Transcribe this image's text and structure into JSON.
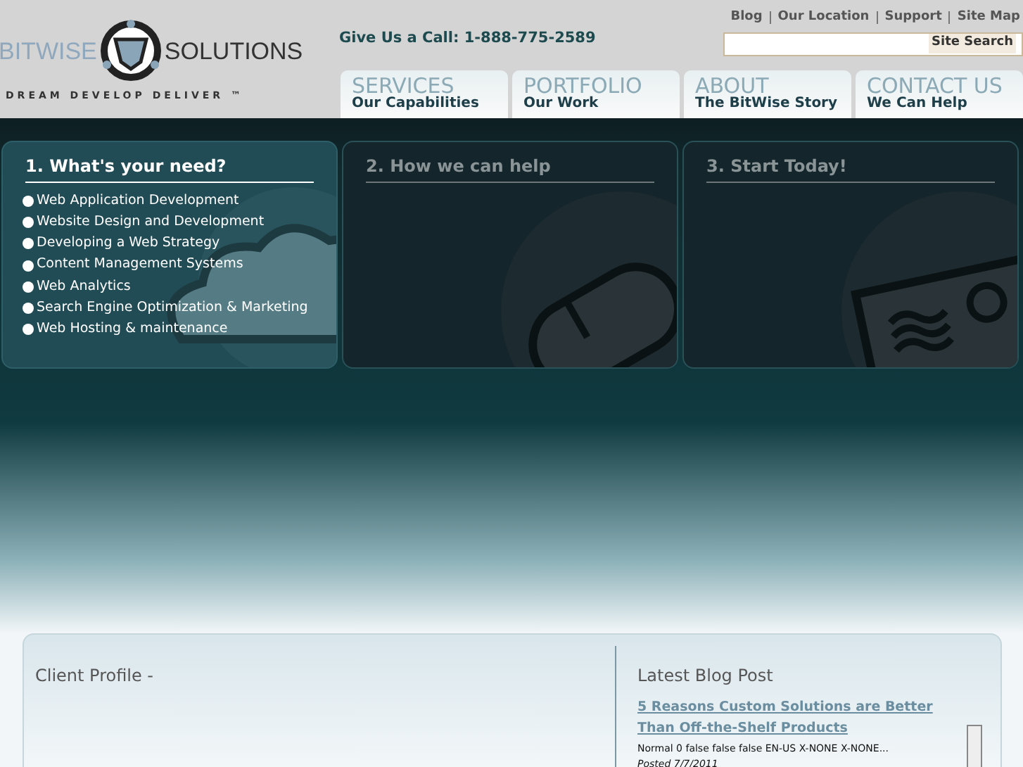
{
  "logo": {
    "left": "BITWISE",
    "right": "SOLUTIONS",
    "tagline": "DREAM DEVELOP DELIVER ™"
  },
  "phone": "Give Us a Call:  1-888-775-2589",
  "top_links": [
    "Blog",
    "Our Location",
    "Support",
    "Site Map"
  ],
  "search": {
    "button": "Site Search"
  },
  "nav": [
    {
      "title": "SERVICES",
      "subtitle": "Our Capabilities"
    },
    {
      "title": "PORTFOLIO",
      "subtitle": "Our Work"
    },
    {
      "title": "ABOUT",
      "subtitle": "The BitWise Story"
    },
    {
      "title": "CONTACT US",
      "subtitle": "We Can Help"
    }
  ],
  "panels": [
    {
      "kind": "cloud",
      "title": "1. What's your need?",
      "selected": true,
      "items": [
        "Web Application Development",
        "Website Design and Development",
        "Developing a Web Strategy",
        "Content Management Systems",
        "Web Analytics",
        "Search Engine Optimization & Marketing",
        "Web Hosting & maintenance"
      ]
    },
    {
      "kind": "mouse",
      "title": "2. How we can help",
      "selected": false
    },
    {
      "kind": "postcard",
      "title": "3. Start Today!",
      "selected": false
    }
  ],
  "client_profile": {
    "title": "Client Profile -"
  },
  "blog": {
    "title": "Latest Blog Post",
    "post_title": "5 Reasons Custom Solutions are Better Than Off-the-Shelf Products",
    "excerpt": "Normal 0 false false false EN-US X-NONE X-NONE...",
    "posted": "Posted 7/7/2011"
  }
}
